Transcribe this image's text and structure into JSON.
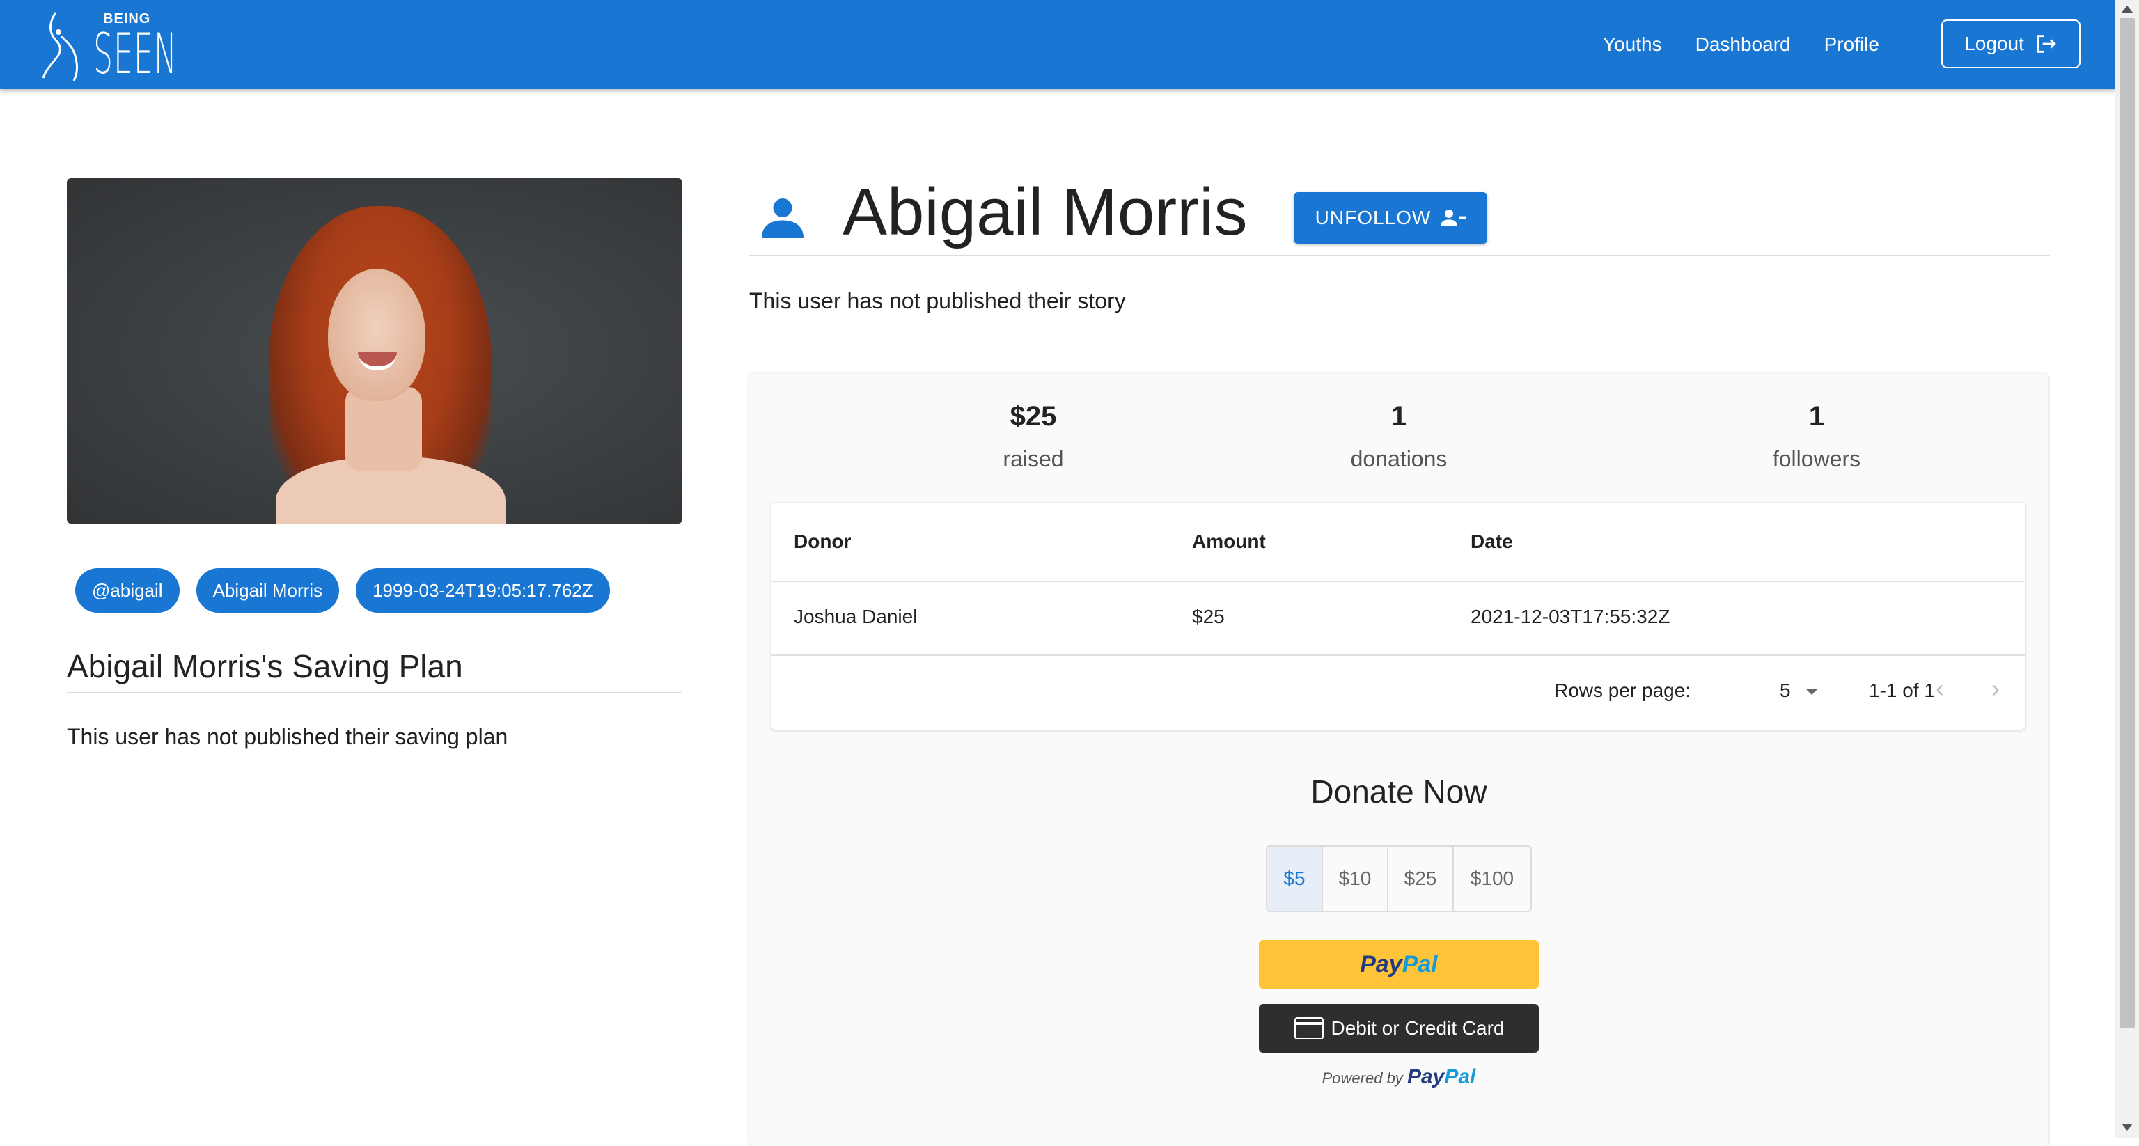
{
  "app": {
    "logo_top": "BEING",
    "logo_bottom": "SEEN",
    "nav": [
      "Youths",
      "Dashboard",
      "Profile"
    ],
    "logout_label": "Logout",
    "primary_color": "#1976d2"
  },
  "profile": {
    "chips": [
      "@abigail",
      "Abigail Morris",
      "1999-03-24T19:05:17.762Z"
    ],
    "saving_plan_title": "Abigail Morris's Saving Plan",
    "saving_plan_text": "This user has not published their saving plan",
    "name": "Abigail Morris",
    "unfollow_label": "UNFOLLOW",
    "story_text": "This user has not published their story"
  },
  "stats": {
    "raised_value": "$25",
    "raised_label": "raised",
    "donations_value": "1",
    "donations_label": "donations",
    "followers_value": "1",
    "followers_label": "followers"
  },
  "donations_table": {
    "headers": [
      "Donor",
      "Amount",
      "Date"
    ],
    "rows": [
      [
        "Joshua Daniel",
        "$25",
        "2021-12-03T17:55:32Z"
      ]
    ],
    "rows_per_page_label": "Rows per page:",
    "rows_per_page_value": "5",
    "range_label": "1-1 of 1"
  },
  "donate": {
    "title": "Donate Now",
    "amounts": [
      "$5",
      "$10",
      "$25",
      "$100"
    ],
    "selected": "$5",
    "paypal_part1": "Pay",
    "paypal_part2": "Pal",
    "card_label": "Debit or Credit Card",
    "powered_by": "Powered by",
    "paypal_colors": {
      "button": "#ffc439",
      "dark": "#253b80",
      "light": "#179bd7"
    }
  }
}
